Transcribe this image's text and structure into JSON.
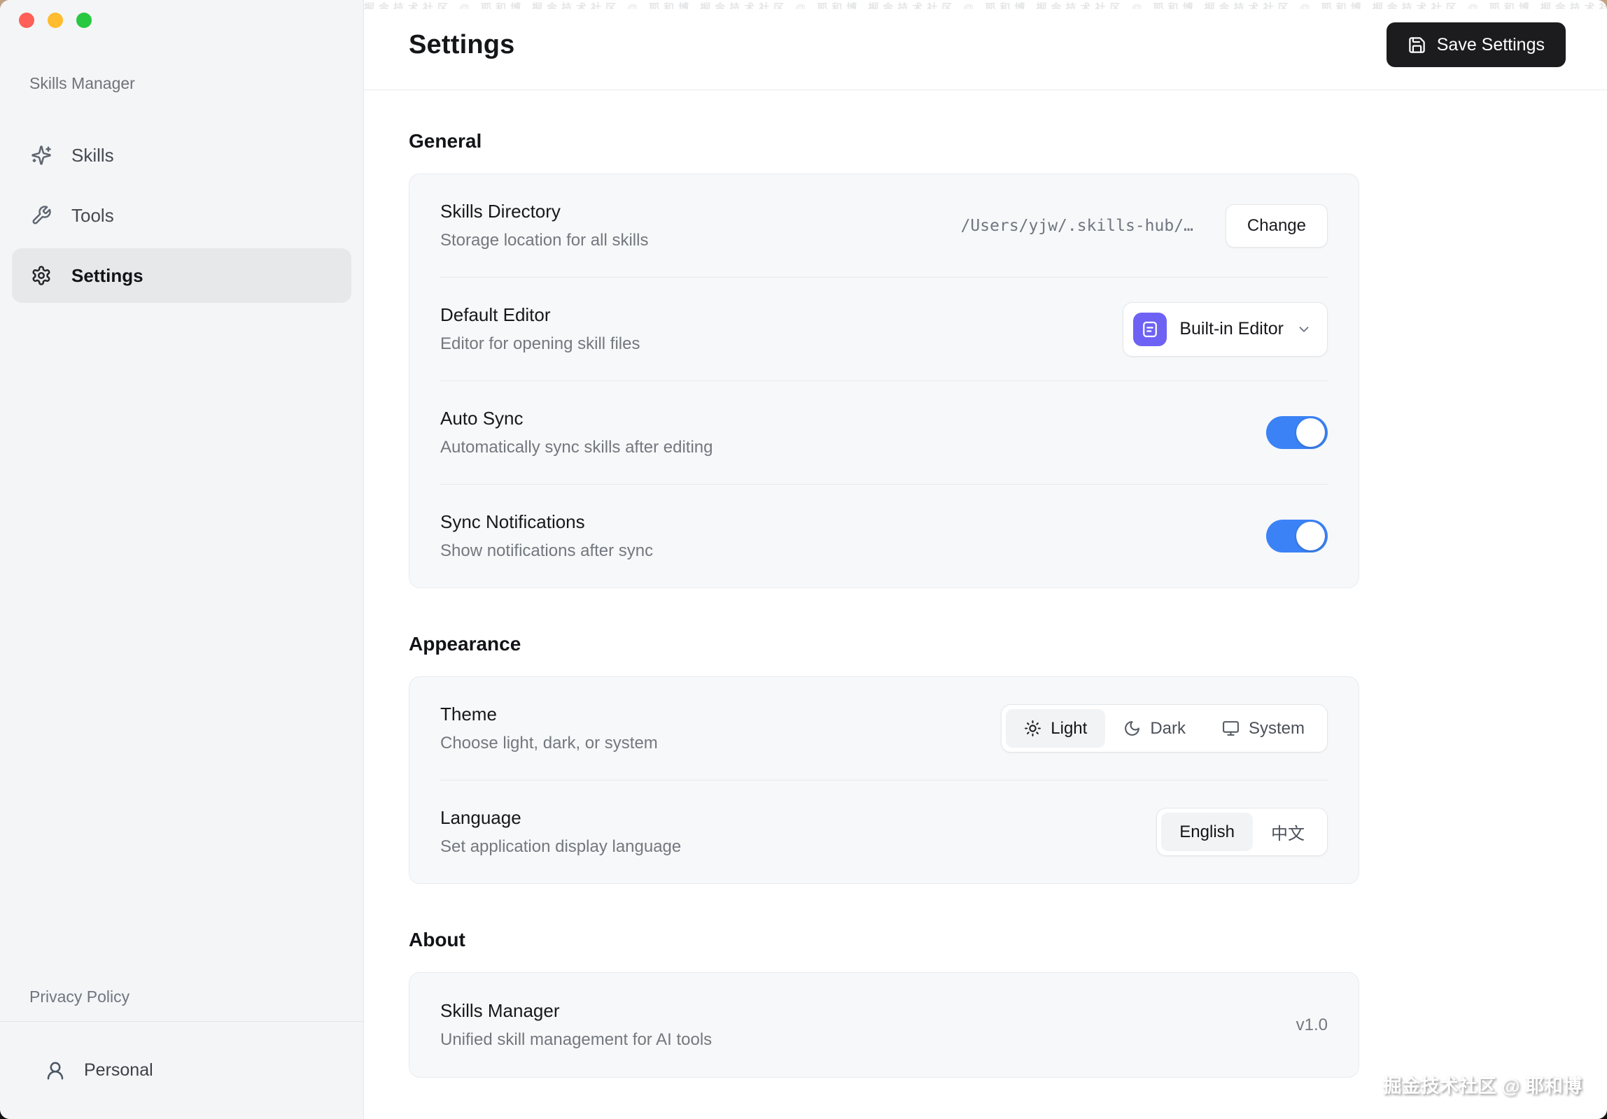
{
  "colors": {
    "traffic_red": "#ff5f57",
    "traffic_yellow": "#febc2e",
    "traffic_green": "#28c840",
    "accent_blue": "#3b82f6",
    "editor_icon_indigo": "#6e62f5",
    "save_button_bg": "#1c1c1e"
  },
  "sidebar": {
    "title": "Skills Manager",
    "items": [
      {
        "label": "Skills",
        "icon": "sparkles-icon",
        "active": false
      },
      {
        "label": "Tools",
        "icon": "wrench-icon",
        "active": false
      },
      {
        "label": "Settings",
        "icon": "gear-icon",
        "active": true
      }
    ],
    "privacy_policy": "Privacy Policy",
    "account": {
      "label": "Personal",
      "icon": "user-icon"
    }
  },
  "header": {
    "title": "Settings",
    "save_button": {
      "label": "Save Settings",
      "icon": "save-icon"
    }
  },
  "sections": {
    "general": {
      "heading": "General",
      "rows": [
        {
          "title": "Skills Directory",
          "subtitle": "Storage location for all skills",
          "value": "/Users/yjw/.skills-hub/…",
          "button": "Change"
        },
        {
          "title": "Default Editor",
          "subtitle": "Editor for opening skill files",
          "dropdown": {
            "label": "Built-in Editor",
            "icon": "editor-file-icon"
          }
        },
        {
          "title": "Auto Sync",
          "subtitle": "Automatically sync skills after editing",
          "toggle": true
        },
        {
          "title": "Sync Notifications",
          "subtitle": "Show notifications after sync",
          "toggle": true
        }
      ]
    },
    "appearance": {
      "heading": "Appearance",
      "theme": {
        "title": "Theme",
        "subtitle": "Choose light, dark, or system",
        "options": [
          {
            "label": "Light",
            "icon": "sun-icon",
            "selected": true
          },
          {
            "label": "Dark",
            "icon": "moon-icon",
            "selected": false
          },
          {
            "label": "System",
            "icon": "monitor-icon",
            "selected": false
          }
        ]
      },
      "language": {
        "title": "Language",
        "subtitle": "Set application display language",
        "options": [
          {
            "label": "English",
            "selected": true
          },
          {
            "label": "中文",
            "selected": false
          }
        ]
      }
    },
    "about": {
      "heading": "About",
      "app_name": "Skills Manager",
      "app_desc": "Unified skill management for AI tools",
      "version": "v1.0"
    }
  },
  "watermark": "掘金技术社区 @ 耶和博"
}
